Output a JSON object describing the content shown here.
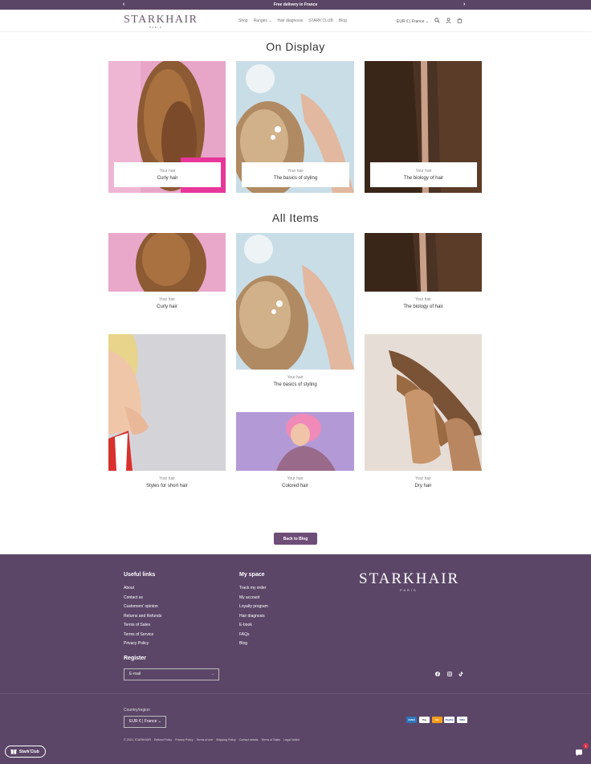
{
  "announcement": {
    "text": "Free delivery in France"
  },
  "header": {
    "logo": "STARKHAIR",
    "logo_sub": "PARIS",
    "nav": [
      "Shop",
      "Ranges",
      "Hair diagnosis",
      "STARK'CLUB",
      "Blog"
    ],
    "currency": "EUR € | France"
  },
  "on_display": {
    "title": "On Display",
    "cards": [
      {
        "kicker": "Your hair",
        "title": "Curly hair"
      },
      {
        "kicker": "Your hair",
        "title": "The basics of styling"
      },
      {
        "kicker": "Your hair",
        "title": "The biology of hair"
      }
    ]
  },
  "all_items": {
    "title": "All Items",
    "cards": [
      {
        "kicker": "Your hair",
        "title": "Curly hair"
      },
      {
        "kicker": "Your hair",
        "title": "The basics of styling"
      },
      {
        "kicker": "Your hair",
        "title": "The biology of hair"
      },
      {
        "kicker": "Your hair",
        "title": "Styles for short hair"
      },
      {
        "kicker": "Your hair",
        "title": "Colored hair"
      },
      {
        "kicker": "Your hair",
        "title": "Dry hair"
      }
    ]
  },
  "back_button": "Back to Blog",
  "footer": {
    "useful_links_title": "Useful links",
    "useful_links": [
      "About",
      "Contact us",
      "Customers' opinion",
      "Returns and Refunds",
      "Terms of Sales",
      "Terms of Service",
      "Privacy Policy"
    ],
    "my_space_title": "My space",
    "my_space": [
      "Track my order",
      "My account",
      "Loyalty program",
      "Hair diagnosis",
      "E-book",
      "FAQs",
      "Blog"
    ],
    "logo": "STARKHAIR",
    "logo_sub": "PARIS",
    "register_title": "Register",
    "email_placeholder": "E-mail",
    "country_label": "Country/region",
    "country_value": "EUR € | France",
    "payments": [
      "AMEX",
      "Pay",
      "MC",
      "PayPal",
      "VISA"
    ],
    "legal": [
      "© 2023, STARKHAIR",
      "Refund Policy",
      "Privacy Policy",
      "Terms of use",
      "Shipping Policy",
      "Contact details",
      "Terms of Sales",
      "Legal Notice"
    ]
  },
  "club_button": "Stark'Club",
  "chat_badge": "1",
  "colors": {
    "brand": "#5b4668",
    "button": "#6e4d77"
  }
}
